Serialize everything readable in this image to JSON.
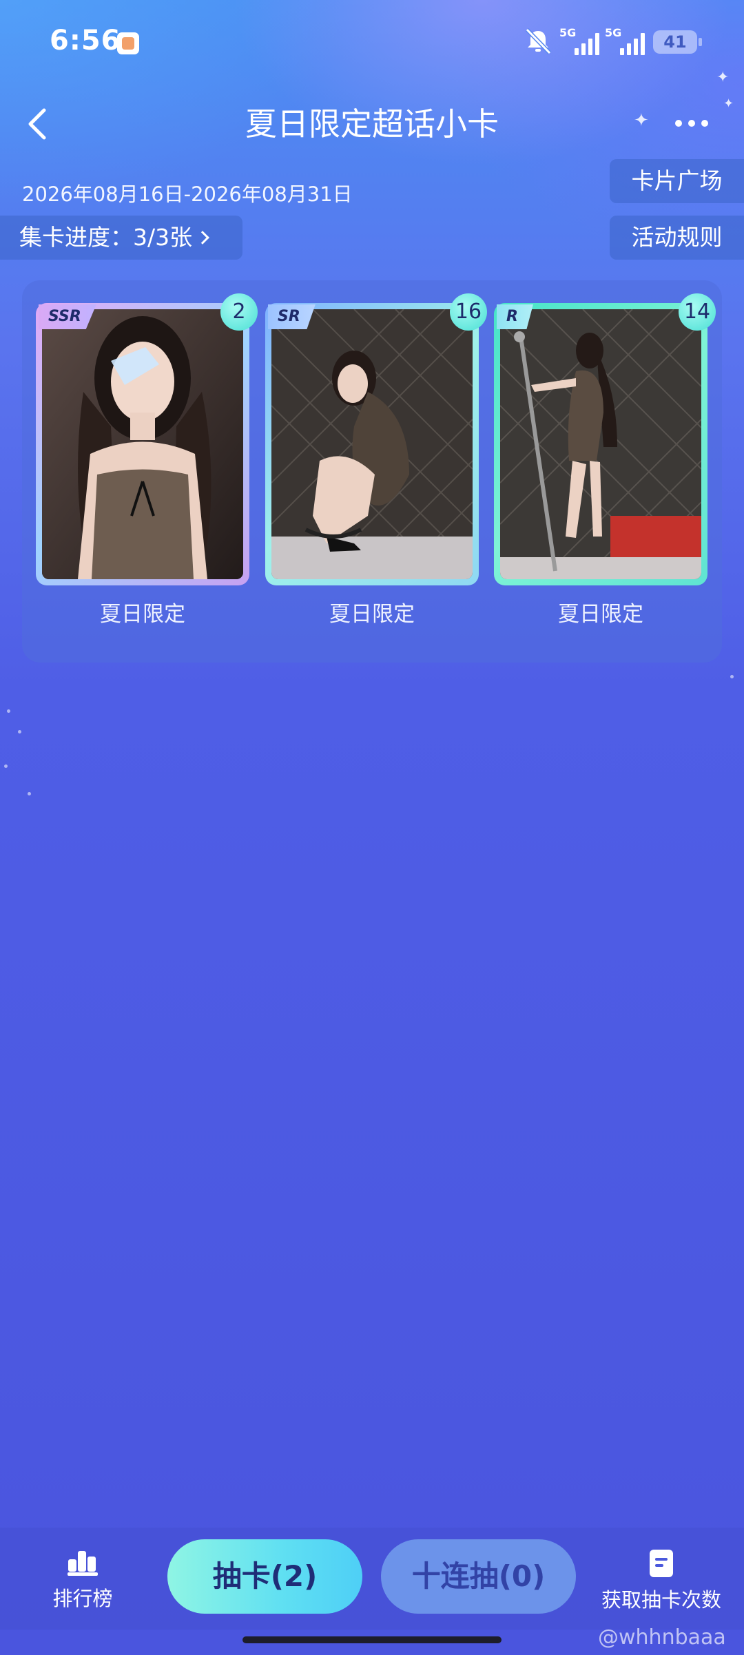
{
  "status_bar": {
    "time": "6:56",
    "network_1": "5G",
    "network_2": "5G",
    "battery": "41"
  },
  "header": {
    "title": "夏日限定超话小卡",
    "date_range": "2026年08月16日-2026年08月31日",
    "progress": "集卡进度：3/3张",
    "card_square": "卡片广场",
    "rules": "活动规则"
  },
  "cards": [
    {
      "rarity": "SSR",
      "count": "2",
      "name": "夏日限定",
      "frame_color": "#c89cf2"
    },
    {
      "rarity": "SR",
      "count": "16",
      "name": "夏日限定",
      "frame_color": "#8fd8f2"
    },
    {
      "rarity": "R",
      "count": "14",
      "name": "夏日限定",
      "frame_color": "#5fe3d2"
    }
  ],
  "bottom_bar": {
    "ranking": "排行榜",
    "draw": "抽卡(2)",
    "ten_draw": "十连抽(0)",
    "get_more": "获取抽卡次数"
  },
  "watermark": "@whhnbaaa"
}
